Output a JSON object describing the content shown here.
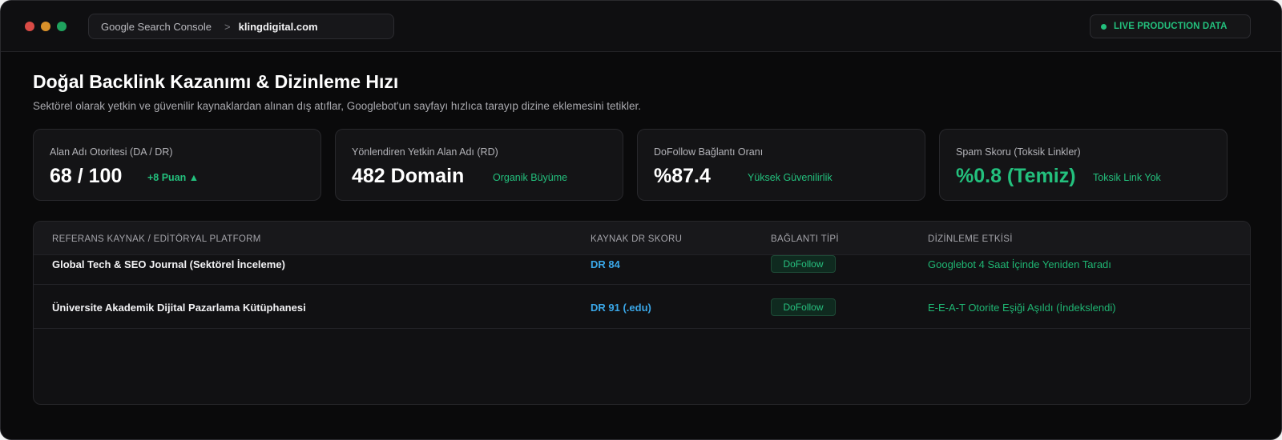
{
  "window": {
    "breadcrumb": {
      "root": "Google Search Console",
      "separator": ">",
      "domain": "klingdigital.com"
    },
    "live_badge": {
      "label": "LIVE PRODUCTION DATA"
    }
  },
  "header": {
    "title": "Doğal Backlink Kazanımı & Dizinleme Hızı",
    "subtitle": "Sektörel olarak yetkin ve güvenilir kaynaklardan alınan dış atıflar, Googlebot'un sayfayı hızlıca tarayıp dizine eklemesini tetikler."
  },
  "cards": [
    {
      "label": "Alan Adı Otoritesi (DA / DR)",
      "value": "68 / 100",
      "note": "+8 Puan ▲"
    },
    {
      "label": "Yönlendiren Yetkin Alan Adı (RD)",
      "value": "482 Domain",
      "note": "Organik Büyüme"
    },
    {
      "label": "DoFollow Bağlantı Oranı",
      "value": "%87.4",
      "note": "Yüksek Güvenilirlik"
    },
    {
      "label": "Spam Skoru (Toksik Linkler)",
      "value": "%0.8 (Temiz)",
      "note": "Toksik Link Yok"
    }
  ],
  "table": {
    "headers": [
      "REFERANS KAYNAK / EDİTÖRYAL PLATFORM",
      "KAYNAK DR SKORU",
      "BAĞLANTI TİPİ",
      "DİZİNLEME ETKİSİ"
    ],
    "rows": [
      {
        "source": "Global Tech & SEO Journal (Sektörel İnceleme)",
        "dr": "DR 84",
        "type": "DoFollow",
        "impact": "Googlebot 4 Saat İçinde Yeniden Taradı"
      },
      {
        "source": "Üniversite Akademik Dijital Pazarlama Kütüphanesi",
        "dr": "DR 91 (.edu)",
        "type": "DoFollow",
        "impact": "E-E-A-T Otorite Eşiği Aşıldı (İndekslendi)"
      }
    ]
  },
  "colors": {
    "accent_green": "#23c07d",
    "dr_blue": "#3aa7e8",
    "background": "#0a0a0b"
  }
}
